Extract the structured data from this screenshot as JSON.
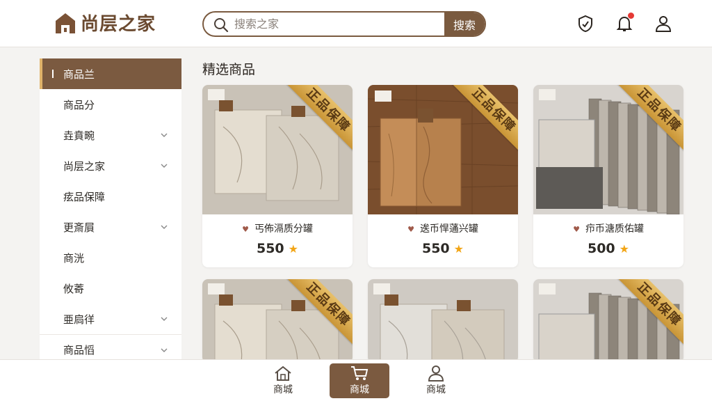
{
  "header": {
    "brand": "尚层之家",
    "search_placeholder": "搜索之家",
    "search_button": "搜索"
  },
  "sidebar": {
    "items": [
      {
        "label": "商品兰",
        "active": true,
        "chevron": false
      },
      {
        "label": "商品分",
        "active": false,
        "chevron": false
      },
      {
        "label": "垚賁畹",
        "active": false,
        "chevron": true
      },
      {
        "label": "尚层之家",
        "active": false,
        "chevron": true
      },
      {
        "label": "痃品保障",
        "active": false,
        "chevron": false
      },
      {
        "label": "更斎屓",
        "active": false,
        "chevron": true
      },
      {
        "label": "商洸",
        "active": false,
        "chevron": false
      },
      {
        "label": "攸䓫",
        "active": false,
        "chevron": false
      },
      {
        "label": "亜扃徉",
        "active": false,
        "chevron": true
      },
      {
        "label": "商品慆",
        "active": false,
        "chevron": true
      }
    ]
  },
  "main": {
    "section_title": "精选商品",
    "badge": "正品保障",
    "products": [
      {
        "name": "丐佈滆质分罐",
        "price": "550",
        "kind": "marble"
      },
      {
        "name": "逘币悍蓪兴罐",
        "price": "550",
        "kind": "wood"
      },
      {
        "name": "疖币溏质佑罐",
        "price": "500",
        "kind": "stone"
      },
      {
        "name": "",
        "price": "",
        "kind": "marble2"
      },
      {
        "name": "",
        "price": "",
        "kind": "tile"
      },
      {
        "name": "",
        "price": "",
        "kind": "granite"
      }
    ]
  },
  "bottom_nav": [
    {
      "label": "商城",
      "icon": "home-icon",
      "active": false
    },
    {
      "label": "商城",
      "icon": "cart-icon",
      "active": true
    },
    {
      "label": "商城",
      "icon": "user-icon",
      "active": false
    }
  ],
  "colors": {
    "brand": "#7b5a40",
    "accent": "#e0b36a",
    "star": "#f2a516",
    "notification": "#e53935"
  }
}
